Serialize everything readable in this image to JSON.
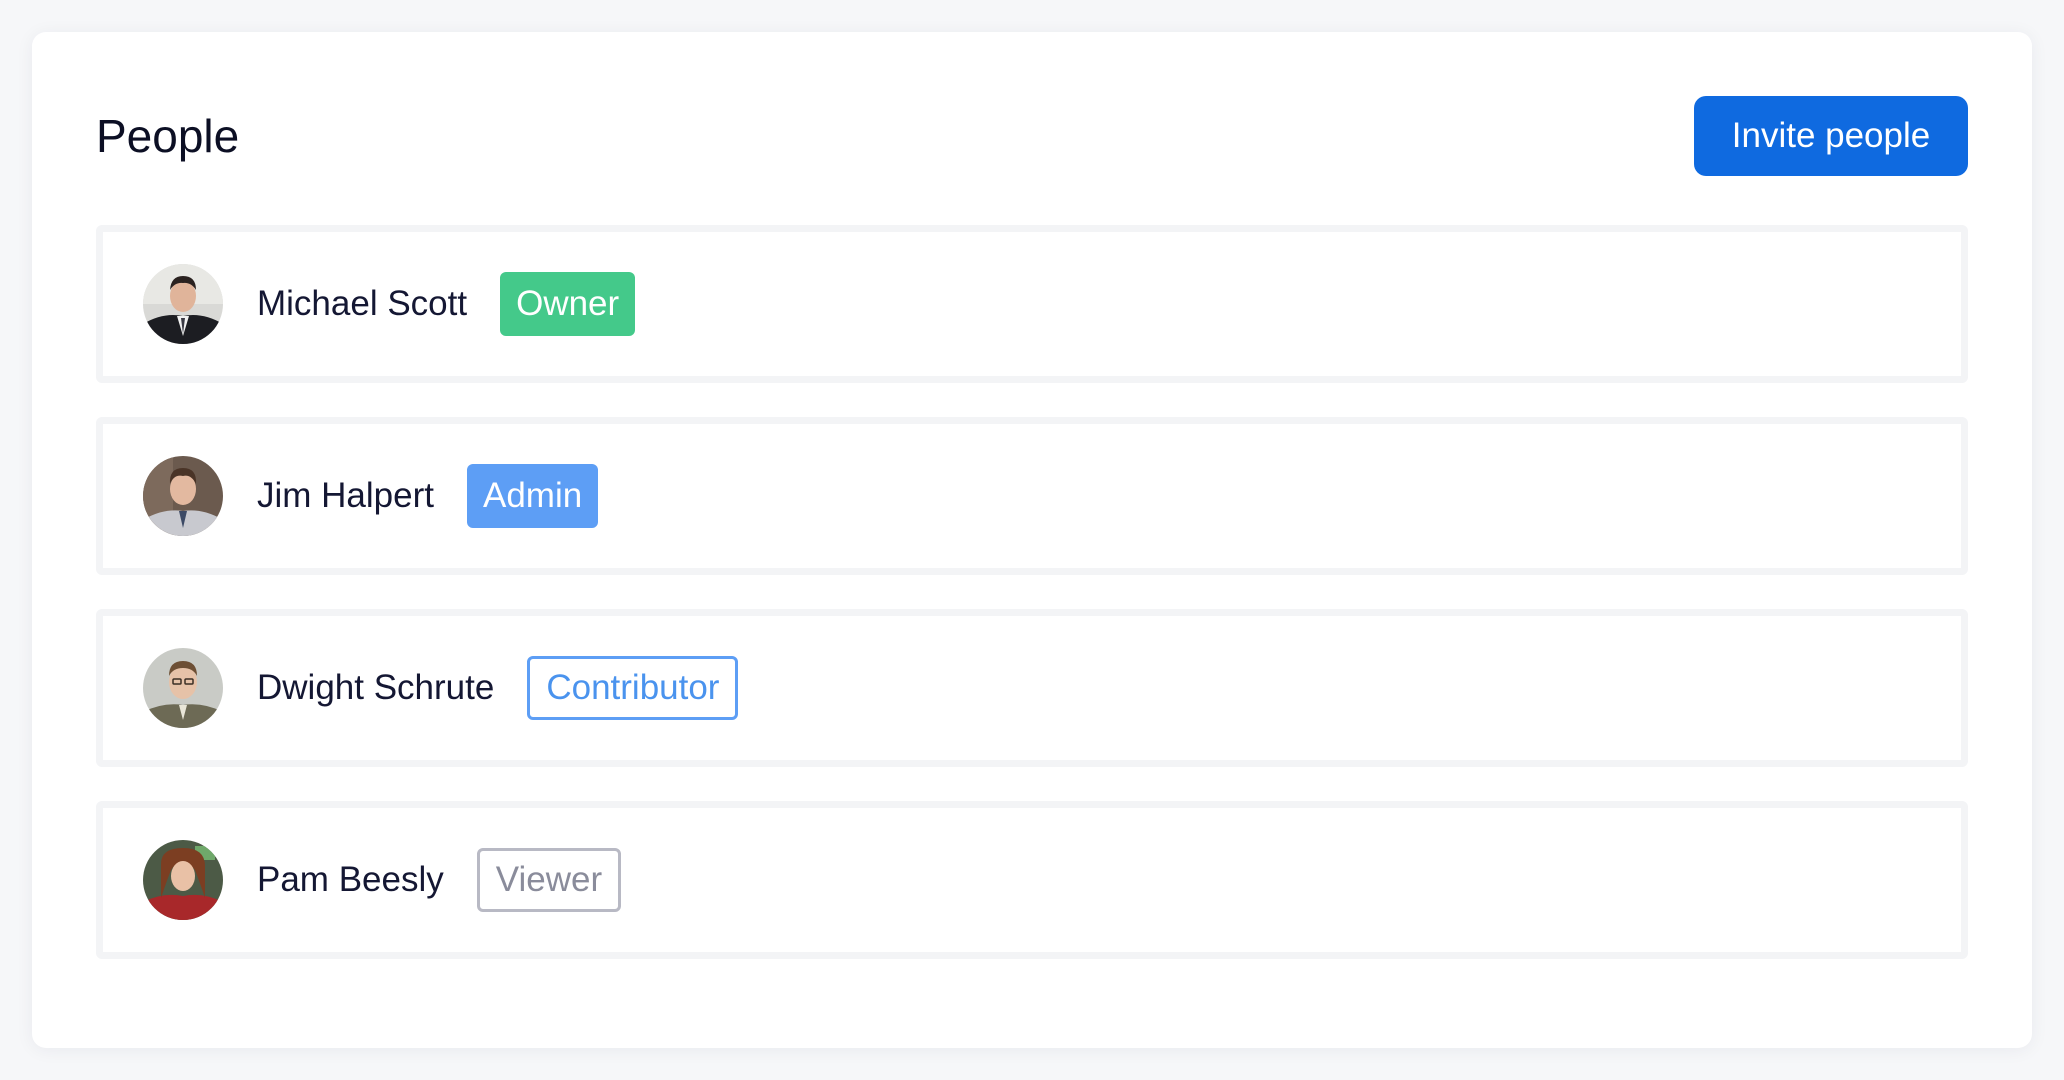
{
  "header": {
    "title": "People",
    "invite_label": "Invite people"
  },
  "colors": {
    "primary": "#0f6ae0",
    "owner": "#44c98a",
    "admin": "#5d9ef5",
    "contributor": "#4a93ee",
    "viewer": "#8a8c9b"
  },
  "people": [
    {
      "name": "Michael Scott",
      "role": "Owner",
      "avatar": "avatar-michael"
    },
    {
      "name": "Jim Halpert",
      "role": "Admin",
      "avatar": "avatar-jim"
    },
    {
      "name": "Dwight Schrute",
      "role": "Contributor",
      "avatar": "avatar-dwight"
    },
    {
      "name": "Pam Beesly",
      "role": "Viewer",
      "avatar": "avatar-pam"
    }
  ]
}
